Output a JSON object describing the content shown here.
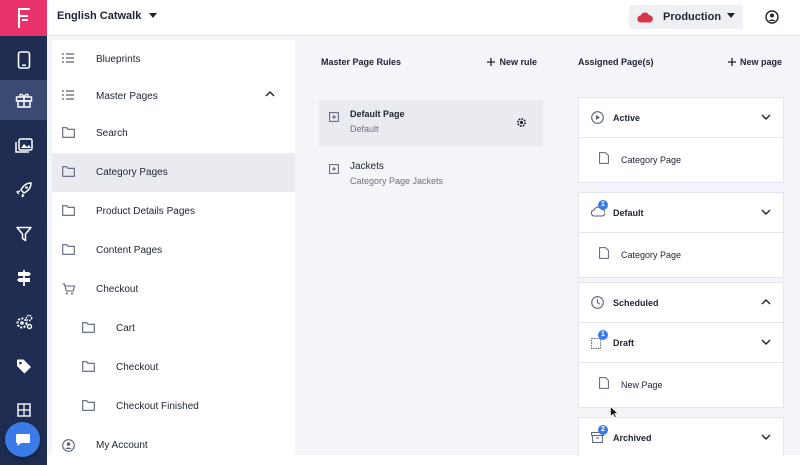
{
  "topbar": {
    "site_name": "English Catwalk",
    "environment": "Production"
  },
  "tree": {
    "items": [
      {
        "label": "Blueprints"
      },
      {
        "label": "Master Pages"
      },
      {
        "label": "Search"
      },
      {
        "label": "Category Pages"
      },
      {
        "label": "Product Details Pages"
      },
      {
        "label": "Content Pages"
      },
      {
        "label": "Checkout"
      },
      {
        "label": "Cart"
      },
      {
        "label": "Checkout"
      },
      {
        "label": "Checkout Finished"
      },
      {
        "label": "My Account"
      }
    ]
  },
  "rules": {
    "header": "Master Page Rules",
    "new_rule": "New rule",
    "items": [
      {
        "name": "Default Page",
        "sub": "Default"
      },
      {
        "name": "Jackets",
        "sub": "Category Page Jackets"
      }
    ]
  },
  "assigned": {
    "header": "Assigned Page(s)",
    "new_page": "New page",
    "groups": [
      {
        "title": "Active",
        "page": "Category Page"
      },
      {
        "title": "Default",
        "badge": "1",
        "page": "Category Page"
      },
      {
        "title": "Scheduled"
      },
      {
        "title": "Draft",
        "badge": "1",
        "page": "New Page"
      },
      {
        "title": "Archived",
        "badge": "2"
      }
    ]
  },
  "colors": {
    "rail": "#1f2d52",
    "brand": "#e8336d",
    "accent": "#3b7be8",
    "cloud": "#d9364a"
  }
}
